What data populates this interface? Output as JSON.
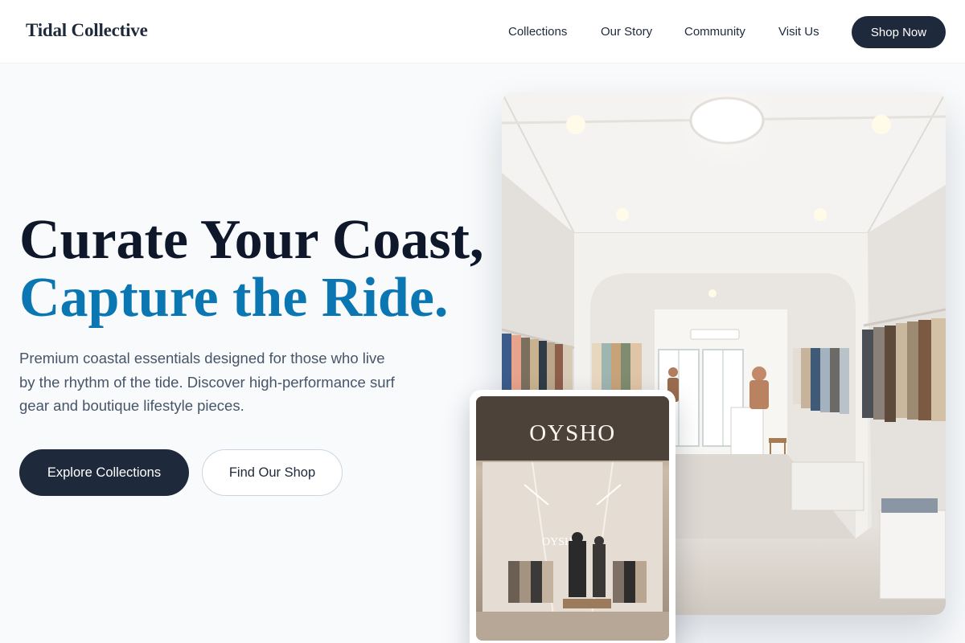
{
  "header": {
    "logo": "Tidal Collective",
    "nav": [
      "Collections",
      "Our Story",
      "Community",
      "Visit Us"
    ],
    "cta": "Shop Now"
  },
  "hero": {
    "headline_line1": "Curate Your Coast,",
    "headline_line2": "Capture the Ride.",
    "description": "Premium coastal essentials designed for those who live by the rhythm of the tide. Discover high-performance surf gear and boutique lifestyle pieces.",
    "primary_button": "Explore Collections",
    "secondary_button": "Find Our Shop"
  },
  "inset_photo": {
    "sign_text": "OYSHO"
  },
  "colors": {
    "accent": "#0a77b3",
    "primary_dark": "#1e293b",
    "background": "#f8fafc"
  }
}
